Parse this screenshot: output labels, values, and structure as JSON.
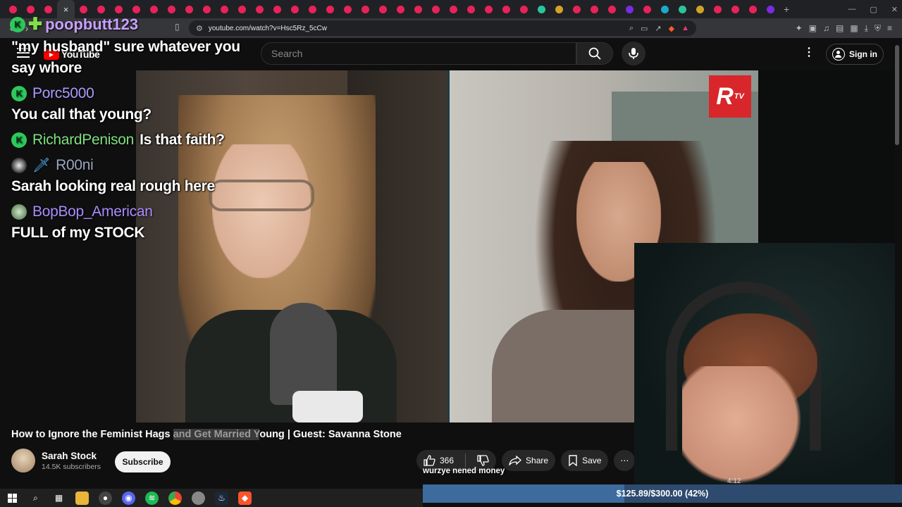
{
  "browser": {
    "tab_count": 44,
    "url": "youtube.com/watch?v=Hsc5Rz_5cCw",
    "new_tab": "+",
    "close_tab": "×"
  },
  "youtube": {
    "logo_text": "YouTube",
    "search_placeholder": "Search",
    "signin_label": "Sign in"
  },
  "overlay": {
    "streamer_name": "poopbutt123"
  },
  "chat": [
    {
      "user": "",
      "text": "\"my husband\" sure whatever you say whore",
      "badge": "none"
    },
    {
      "user": "Porc5000",
      "text": "You call that young?",
      "badge": "kick",
      "user_color": "#9b8cff"
    },
    {
      "user": "RichardPenison",
      "text": "Is that faith?",
      "badge": "kick",
      "user_color": "#7ee07e",
      "inline": true
    },
    {
      "user": "R00ni",
      "text": "Sarah looking real rough here",
      "badge": "avatar-sword",
      "user_color": "#9aa6c0"
    },
    {
      "user": "BopBop_American",
      "text": "FULL of my STOCK",
      "badge": "avatar",
      "user_color": "#a98cff"
    }
  ],
  "video": {
    "title_part1": "How to Ignore the Feminist Hags ",
    "title_highlight": "and Get Married Y",
    "title_part2": "oung | Guest: Savanna Stone",
    "channel": "Sarah Stock",
    "subscribers": "14.5K subscribers",
    "subscribe_label": "Subscribe",
    "likes": "366",
    "share_label": "Share",
    "save_label": "Save",
    "watermark": "R",
    "watermark_sup": "TV"
  },
  "stream": {
    "donation_ticker": "wurzye nened money",
    "time": "4:12",
    "goal_text": "$125.89/$300.00 (42%)",
    "goal_fraction": 0.42
  },
  "colors": {
    "kick_green": "#2ec95c",
    "yt_red": "#ff0000",
    "goal_bg": "#2e4a6e"
  }
}
